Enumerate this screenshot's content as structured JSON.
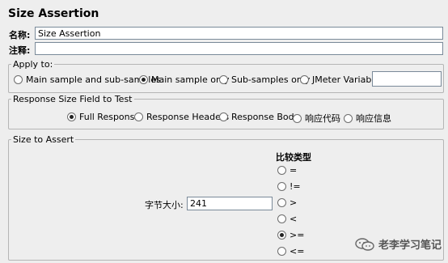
{
  "title": "Size Assertion",
  "name_row": {
    "label": "名称:",
    "value": "Size Assertion"
  },
  "comment_row": {
    "label": "注释:",
    "value": ""
  },
  "apply_to": {
    "legend": "Apply to:",
    "options": [
      {
        "label": "Main sample and sub-samples",
        "checked": false
      },
      {
        "label": "Main sample only",
        "checked": true
      },
      {
        "label": "Sub-samples only",
        "checked": false
      },
      {
        "label": "JMeter Variable",
        "checked": false
      }
    ],
    "variable_value": ""
  },
  "response_field": {
    "legend": "Response Size Field to Test",
    "options": [
      {
        "label": "Full Response",
        "checked": true
      },
      {
        "label": "Response Headers",
        "checked": false
      },
      {
        "label": "Response Body",
        "checked": false
      },
      {
        "label": "响应代码",
        "checked": false
      },
      {
        "label": "响应信息",
        "checked": false
      }
    ]
  },
  "size_to_assert": {
    "legend": "Size to Assert",
    "byte_size_label": "字节大小:",
    "byte_size_value": "241",
    "compare_title": "比较类型",
    "operators": [
      {
        "label": "=",
        "checked": false
      },
      {
        "label": "!=",
        "checked": false
      },
      {
        "label": ">",
        "checked": false
      },
      {
        "label": "<",
        "checked": false
      },
      {
        "label": ">=",
        "checked": true
      },
      {
        "label": "<=",
        "checked": false
      }
    ]
  },
  "watermark": {
    "text": "老李学习笔记",
    "icon": "wechat-icon"
  }
}
